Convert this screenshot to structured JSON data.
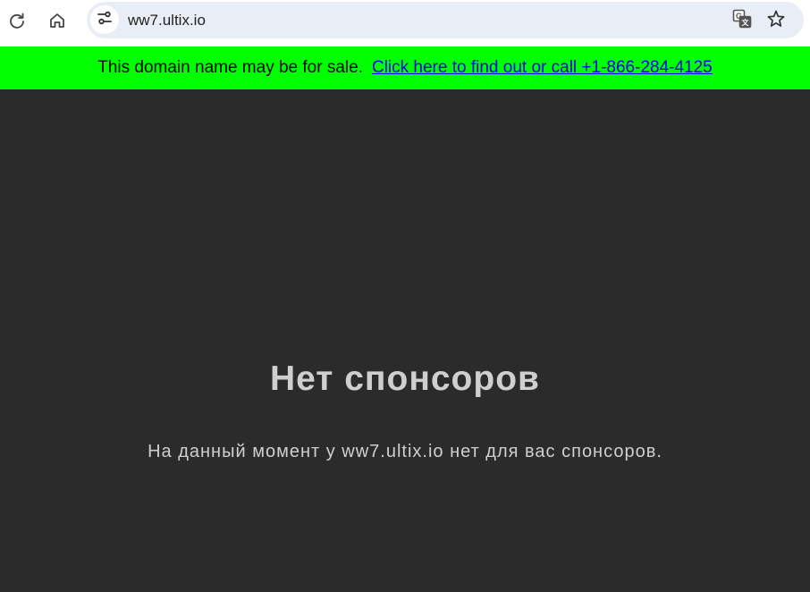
{
  "browser": {
    "url": "ww7.ultix.io",
    "icons": {
      "reload": "reload-icon",
      "home": "home-icon",
      "site_info": "tune-icon",
      "translate": "translate-icon",
      "bookmark": "star-icon"
    }
  },
  "banner": {
    "text": "This domain name may be for sale.",
    "link_text": "Click here to find out or call +1-866-284-4125",
    "background": "#00ff00",
    "link_color": "#0000ee"
  },
  "page": {
    "heading": "Нет спонсоров",
    "message": "На данный момент у ww7.ultix.io нет для вас спонсоров.",
    "background": "#2b2b2b",
    "text_color": "#cfcfcf"
  }
}
